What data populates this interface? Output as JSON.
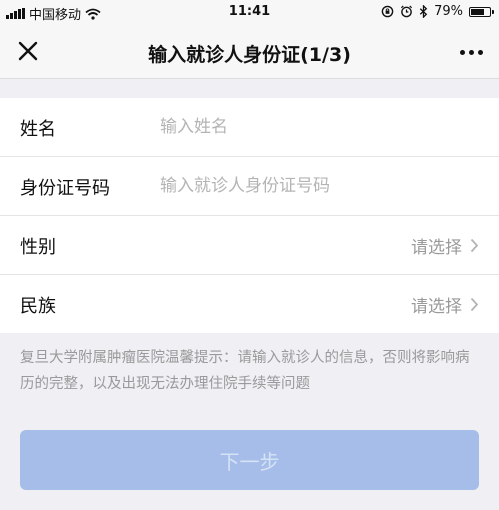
{
  "status_bar": {
    "carrier": "中国移动",
    "time": "11:41",
    "battery_percent_text": "79%",
    "battery_level": 0.79,
    "icons": [
      "signal-icon",
      "wifi-icon",
      "rotation-lock-icon",
      "alarm-icon",
      "bluetooth-icon",
      "battery-icon"
    ]
  },
  "header": {
    "close_icon": "close-icon",
    "title": "输入就诊人身份证(1/3)",
    "more_icon": "more-icon"
  },
  "form": {
    "name": {
      "label": "姓名",
      "placeholder": "输入姓名",
      "value": ""
    },
    "id_number": {
      "label": "身份证号码",
      "placeholder": "输入就诊人身份证号码",
      "value": ""
    },
    "gender": {
      "label": "性别",
      "selected": "请选择"
    },
    "ethnicity": {
      "label": "民族",
      "selected": "请选择"
    }
  },
  "tip": "复旦大学附属肿瘤医院温馨提示：请输入就诊人的信息，否则将影响病历的完整，以及出现无法办理住院手续等问题",
  "next_button": {
    "label": "下一步",
    "enabled": false
  },
  "colors": {
    "background": "#efeff4",
    "button_disabled": "#a5bde8",
    "button_text_disabled": "#d6e2f6",
    "placeholder": "#b4b4b4",
    "hint_text": "#9a9a9a"
  }
}
